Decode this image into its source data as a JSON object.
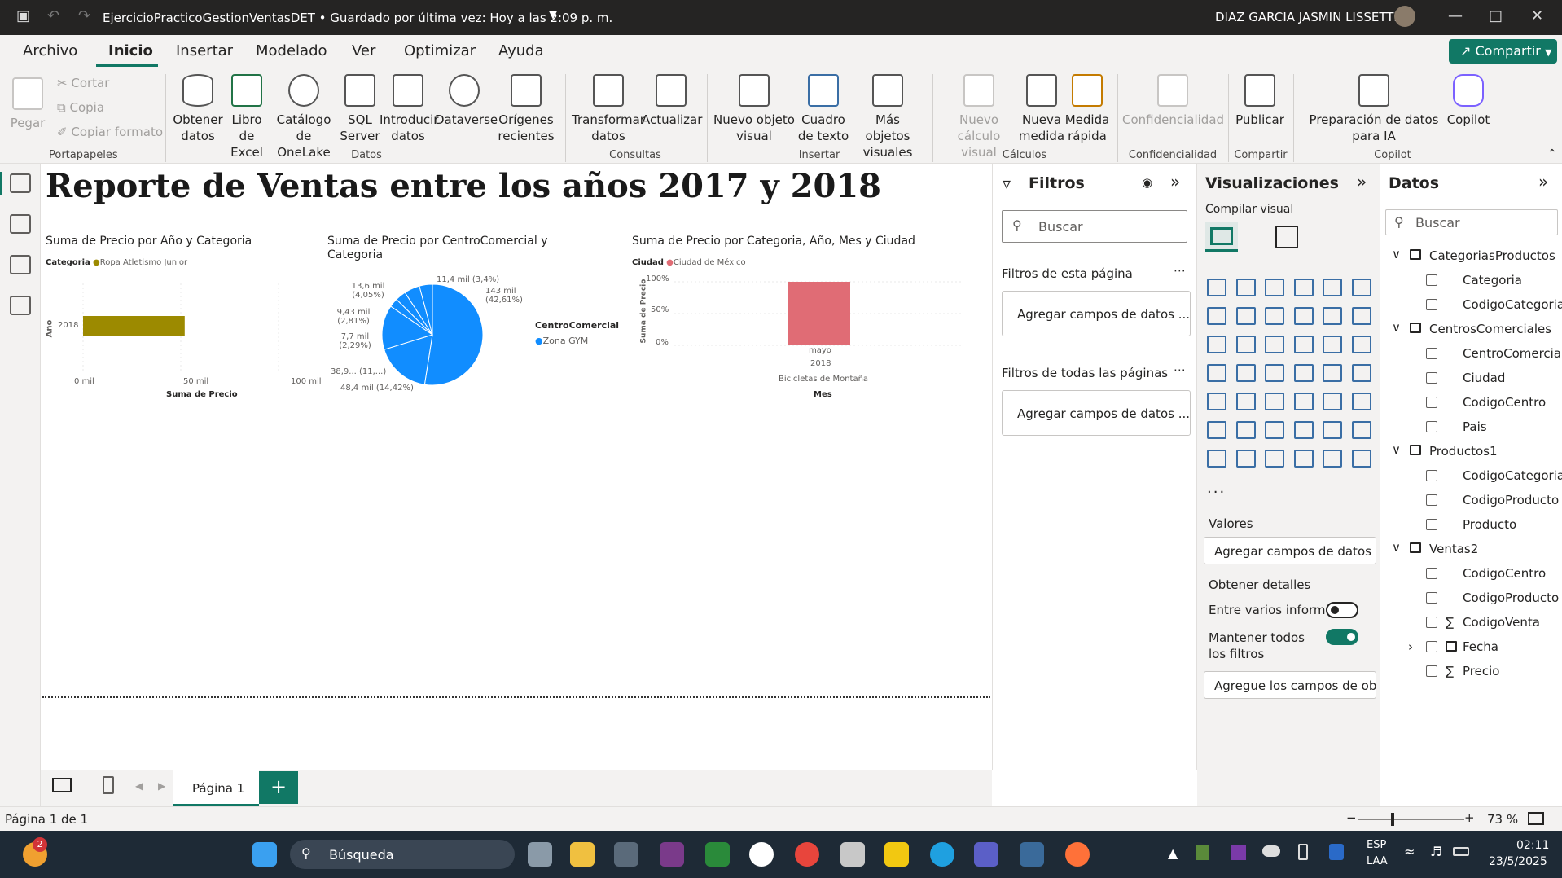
{
  "titlebar": {
    "document": "EjercicioPracticoGestionVentasDET • Guardado por última vez: Hoy a las 2:09 p. m.",
    "user": "DIAZ GARCIA JASMIN LISSETTE"
  },
  "menu": {
    "tabs": [
      "Archivo",
      "Inicio",
      "Insertar",
      "Modelado",
      "Ver",
      "Optimizar",
      "Ayuda"
    ],
    "active": "Inicio",
    "share": "Compartir"
  },
  "ribbon": {
    "clipboard": {
      "paste": "Pegar",
      "cut": "Cortar",
      "copy": "Copia",
      "format": "Copiar formato",
      "group": "Portapapeles"
    },
    "data": {
      "buttons": [
        "Obtener datos",
        "Libro de Excel",
        "Catálogo de OneLake",
        "SQL Server",
        "Introducir datos",
        "Dataverse",
        "Orígenes recientes"
      ],
      "group": "Datos"
    },
    "queries": {
      "buttons": [
        "Transformar datos",
        "Actualizar"
      ],
      "group": "Consultas"
    },
    "insert": {
      "buttons": [
        "Nuevo objeto visual",
        "Cuadro de texto",
        "Más objetos visuales"
      ],
      "group": "Insertar"
    },
    "calcs": {
      "buttons": [
        "Nuevo cálculo visual",
        "Nueva medida",
        "Medida rápida"
      ],
      "group": "Cálculos"
    },
    "confidential": {
      "buttons": [
        "Confidencialidad"
      ],
      "group": "Confidencialidad"
    },
    "share": {
      "buttons": [
        "Publicar"
      ],
      "group": "Compartir"
    },
    "copilot": {
      "buttons": [
        "Preparación de datos para IA",
        "Copilot"
      ],
      "group": "Copilot"
    }
  },
  "report": {
    "title": "Reporte de Ventas entre los años 2017 y 2018"
  },
  "visual1": {
    "title": "Suma de Precio por Año y Categoria",
    "legend_title": "Categoria",
    "legend_item": "Ropa Atletismo Junior",
    "ylabel": "Año",
    "xlabel": "Suma de Precio",
    "ticks": [
      "0 mil",
      "50 mil",
      "100 mil"
    ],
    "category": "2018"
  },
  "visual2": {
    "title": "Suma de Precio por CentroComercial y Categoria",
    "legend_title": "CentroComercial",
    "legend_item": "Zona GYM",
    "labels": [
      "11,4 mil (3,4%)",
      "143 mil (42,61%)",
      "13,6 mil (4,05%)",
      "9,43 mil (2,81%)",
      "7,7 mil (2,29%)",
      "38,9... (11,...)",
      "48,4 mil (14,42%)"
    ]
  },
  "visual3": {
    "title": "Suma de Precio por Categoria, Año, Mes y Ciudad",
    "legend_title": "Ciudad",
    "legend_item": "Ciudad de México",
    "ylabel": "Suma de Precio",
    "yticks": [
      "100%",
      "50%",
      "0%"
    ],
    "xcat": [
      "mayo",
      "2018",
      "Bicicletas de Montaña"
    ],
    "xlabel": "Mes"
  },
  "chart_data": [
    {
      "type": "bar",
      "title": "Suma de Precio por Año y Categoria",
      "categories": [
        "2018"
      ],
      "series": [
        {
          "name": "Ropa Atletismo Junior",
          "values": [
            52000
          ]
        }
      ],
      "xlabel": "Suma de Precio",
      "ylabel": "Año",
      "xlim": [
        0,
        100000
      ],
      "color": "#9c8a00"
    },
    {
      "type": "pie",
      "title": "Suma de Precio por CentroComercial y Categoria",
      "slices": [
        {
          "label": "143 mil (42,61%)",
          "value": 143000
        },
        {
          "label": "48,4 mil (14,42%)",
          "value": 48400
        },
        {
          "label": "38,9... (11,...)",
          "value": 38900
        },
        {
          "label": "7,7 mil (2,29%)",
          "value": 7700
        },
        {
          "label": "9,43 mil (2,81%)",
          "value": 9430
        },
        {
          "label": "13,6 mil (4,05%)",
          "value": 13600
        },
        {
          "label": "11,4 mil (3,4%)",
          "value": 11400
        }
      ],
      "color": "#118dff"
    },
    {
      "type": "bar",
      "title": "Suma de Precio por Categoria, Año, Mes y Ciudad",
      "categories": [
        "mayo 2018 Bicicletas de Montaña"
      ],
      "series": [
        {
          "name": "Ciudad de México",
          "values": [
            100
          ]
        }
      ],
      "ylabel": "Suma de Precio",
      "xlabel": "Mes",
      "ylim": [
        0,
        100
      ],
      "color": "#e06c75"
    }
  ],
  "filters": {
    "title": "Filtros",
    "search": "Buscar",
    "page_label": "Filtros de esta página",
    "page_drop": "Agregar campos de datos ...",
    "all_label": "Filtros de todas las páginas",
    "all_drop": "Agregar campos de datos ..."
  },
  "visualizations": {
    "title": "Visualizaciones",
    "build": "Compilar visual",
    "values": "Valores",
    "values_drop": "Agregar campos de datos a...",
    "drill": "Obtener detalles",
    "cross_report": "Entre varios informes",
    "keep_filters": "Mantener todos los filtros",
    "drill_drop": "Agregue los campos de ob...",
    "more": "..."
  },
  "data_pane": {
    "title": "Datos",
    "search": "Buscar",
    "tables": [
      {
        "name": "CategoriasProductos",
        "fields": [
          "Categoria",
          "CodigoCategoria"
        ]
      },
      {
        "name": "CentrosComerciales",
        "fields": [
          "CentroComercial",
          "Ciudad",
          "CodigoCentro",
          "Pais"
        ]
      },
      {
        "name": "Productos1",
        "fields": [
          "CodigoCategoria",
          "CodigoProducto",
          "Producto"
        ]
      },
      {
        "name": "Ventas2",
        "fields": [
          "CodigoCentro",
          "CodigoProducto",
          "CodigoVenta",
          "Fecha",
          "Precio"
        ]
      }
    ]
  },
  "pages": {
    "tab": "Página 1",
    "status": "Página 1 de 1",
    "zoom": "73 %"
  },
  "taskbar": {
    "search": "Búsqueda",
    "lang1": "ESP",
    "lang2": "LAA",
    "time": "02:11",
    "date": "23/5/2025",
    "badge": "2"
  }
}
